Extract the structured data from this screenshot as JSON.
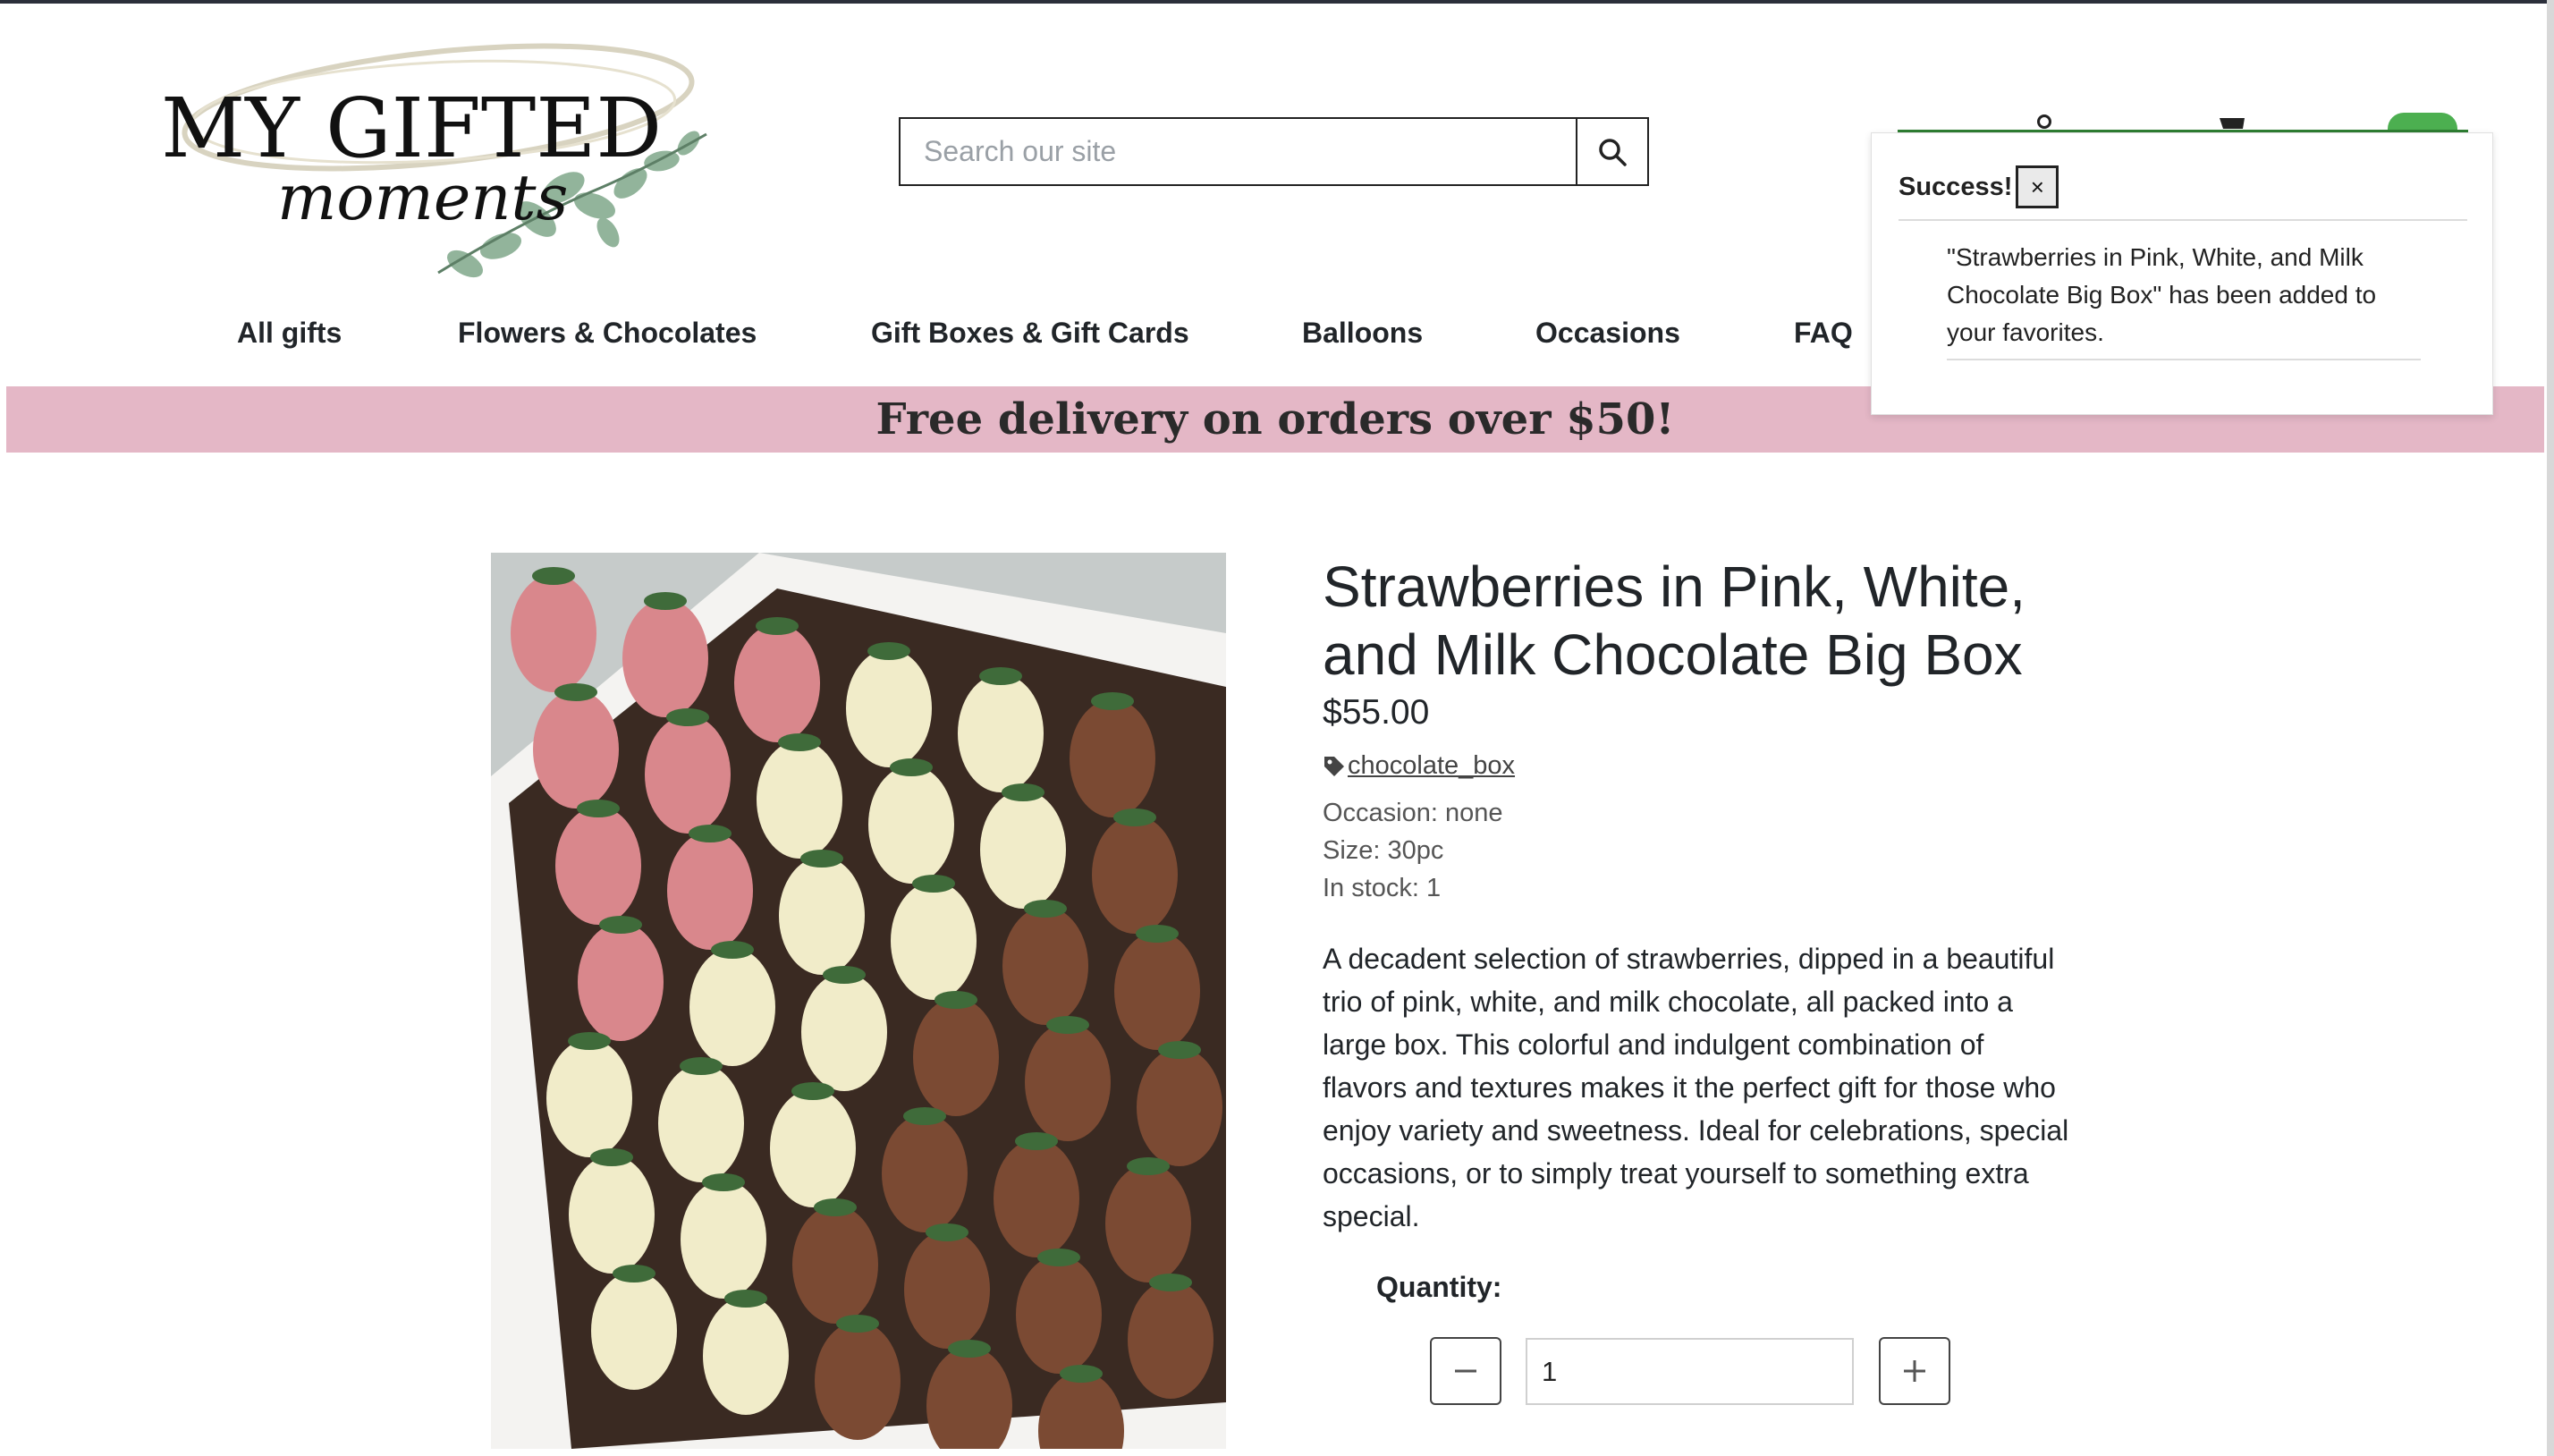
{
  "header": {
    "logo": {
      "line1": "MY GIFTED",
      "line2": "moments"
    },
    "search": {
      "placeholder": "Search our site",
      "value": ""
    }
  },
  "nav": {
    "items": [
      {
        "label": "All gifts"
      },
      {
        "label": "Flowers & Chocolates"
      },
      {
        "label": "Gift Boxes & Gift Cards"
      },
      {
        "label": "Balloons"
      },
      {
        "label": "Occasions"
      },
      {
        "label": "FAQ"
      }
    ]
  },
  "banner": {
    "text": "Free delivery on orders over $50!"
  },
  "popup": {
    "title": "Success!",
    "close_label": "×",
    "message": "\"Strawberries in Pink, White, and Milk Chocolate Big Box\" has been added to your favorites."
  },
  "product": {
    "title": "Strawberries in Pink, White, and Milk Chocolate Big Box",
    "price": "$55.00",
    "tag": "chocolate_box",
    "occasion": "Occasion: none",
    "size": "Size: 30pc",
    "stock": "In stock: 1",
    "description": "A decadent selection of strawberries, dipped in a beautiful trio of pink, white, and milk chocolate, all packed into a large box. This colorful and indulgent combination of flavors and textures makes it the perfect gift for those who enjoy variety and sweetness. Ideal for celebrations, special occasions, or to simply treat yourself to something extra special.",
    "quantity_label": "Quantity:",
    "quantity_value": "1"
  },
  "colors": {
    "banner_bg": "#e4b7c6",
    "success_green": "#4caf50",
    "text": "#212529"
  },
  "icons": [
    "search-icon",
    "user-icon",
    "cart-icon",
    "tag-icon",
    "close-icon",
    "minus-icon",
    "plus-icon"
  ]
}
